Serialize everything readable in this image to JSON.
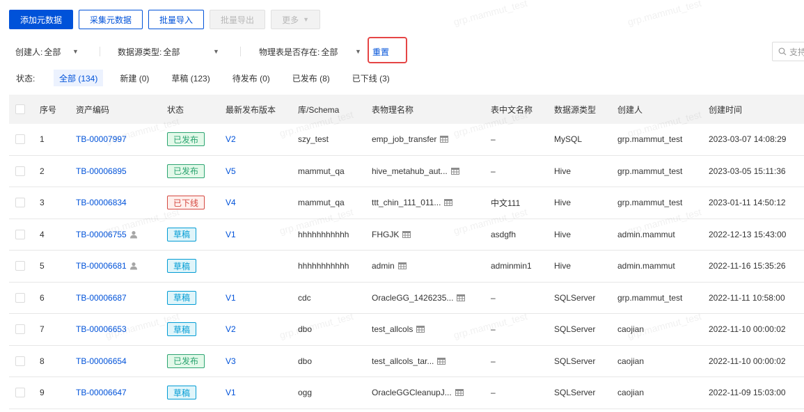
{
  "toolbar": {
    "add_label": "添加元数据",
    "collect_label": "采集元数据",
    "import_label": "批量导入",
    "export_label": "批量导出",
    "more_label": "更多"
  },
  "filters": {
    "creator_label": "创建人:",
    "creator_value": "全部",
    "source_type_label": "数据源类型:",
    "source_type_value": "全部",
    "physical_exists_label": "物理表是否存在:",
    "physical_exists_value": "全部",
    "reset_label": "重置",
    "search_placeholder": "支持"
  },
  "status_bar": {
    "label": "状态:",
    "tabs": [
      {
        "label": "全部 (134)"
      },
      {
        "label": "新建 (0)"
      },
      {
        "label": "草稿 (123)"
      },
      {
        "label": "待发布 (0)"
      },
      {
        "label": "已发布 (8)"
      },
      {
        "label": "已下线 (3)"
      }
    ]
  },
  "table": {
    "columns": [
      "序号",
      "资产编码",
      "状态",
      "最新发布版本",
      "库/Schema",
      "表物理名称",
      "表中文名称",
      "数据源类型",
      "创建人",
      "创建时间"
    ],
    "rows": [
      {
        "idx": "1",
        "code": "TB-00007997",
        "owner_icon": false,
        "status": "已发布",
        "version": "V2",
        "schema": "szy_test",
        "physical": "emp_job_transfer",
        "cn_name": "–",
        "type": "MySQL",
        "creator": "grp.mammut_test",
        "time": "2023-03-07 14:08:29"
      },
      {
        "idx": "2",
        "code": "TB-00006895",
        "owner_icon": false,
        "status": "已发布",
        "version": "V5",
        "schema": "mammut_qa",
        "physical": "hive_metahub_aut...",
        "cn_name": "–",
        "type": "Hive",
        "creator": "grp.mammut_test",
        "time": "2023-03-05 15:11:36"
      },
      {
        "idx": "3",
        "code": "TB-00006834",
        "owner_icon": false,
        "status": "已下线",
        "version": "V4",
        "schema": "mammut_qa",
        "physical": "ttt_chin_111_011...",
        "cn_name": "中文111",
        "type": "Hive",
        "creator": "grp.mammut_test",
        "time": "2023-01-11 14:50:12"
      },
      {
        "idx": "4",
        "code": "TB-00006755",
        "owner_icon": true,
        "status": "草稿",
        "version": "V1",
        "schema": "hhhhhhhhhhh",
        "physical": "FHGJK",
        "cn_name": "asdgfh",
        "type": "Hive",
        "creator": "admin.mammut",
        "time": "2022-12-13 15:43:00"
      },
      {
        "idx": "5",
        "code": "TB-00006681",
        "owner_icon": true,
        "status": "草稿",
        "version": "",
        "schema": "hhhhhhhhhhh",
        "physical": "admin",
        "cn_name": "adminmin1",
        "type": "Hive",
        "creator": "admin.mammut",
        "time": "2022-11-16 15:35:26"
      },
      {
        "idx": "6",
        "code": "TB-00006687",
        "owner_icon": false,
        "status": "草稿",
        "version": "V1",
        "schema": "cdc",
        "physical": "OracleGG_1426235...",
        "cn_name": "–",
        "type": "SQLServer",
        "creator": "grp.mammut_test",
        "time": "2022-11-11 10:58:00"
      },
      {
        "idx": "7",
        "code": "TB-00006653",
        "owner_icon": false,
        "status": "草稿",
        "version": "V2",
        "schema": "dbo",
        "physical": "test_allcols",
        "cn_name": "–",
        "type": "SQLServer",
        "creator": "caojian",
        "time": "2022-11-10 00:00:02"
      },
      {
        "idx": "8",
        "code": "TB-00006654",
        "owner_icon": false,
        "status": "已发布",
        "version": "V3",
        "schema": "dbo",
        "physical": "test_allcols_tar...",
        "cn_name": "–",
        "type": "SQLServer",
        "creator": "caojian",
        "time": "2022-11-10 00:00:02"
      },
      {
        "idx": "9",
        "code": "TB-00006647",
        "owner_icon": false,
        "status": "草稿",
        "version": "V1",
        "schema": "ogg",
        "physical": "OracleGGCleanupJ...",
        "cn_name": "–",
        "type": "SQLServer",
        "creator": "caojian",
        "time": "2022-11-09 15:03:00"
      }
    ]
  },
  "status_colors": {
    "已发布": "#2ba471",
    "已下线": "#d54941",
    "草稿": "#029cd4"
  },
  "status_bg": {
    "已发布": "#e3f9e9",
    "已下线": "#fff0ed",
    "草稿": "#e0f5fa"
  },
  "watermark": "grp.mammut_test"
}
